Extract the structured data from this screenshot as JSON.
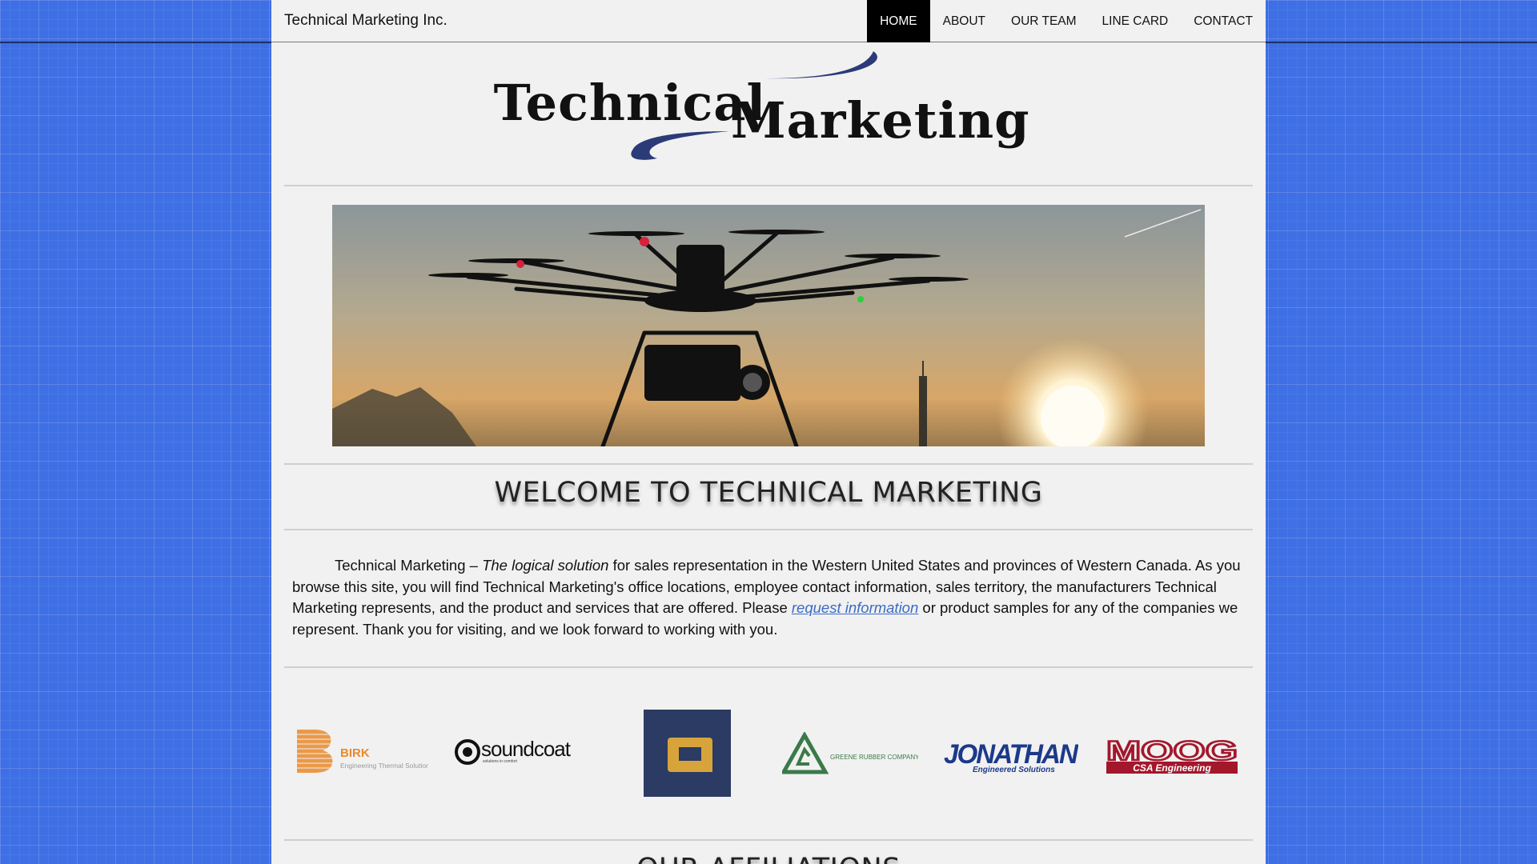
{
  "header": {
    "brand": "Technical Marketing Inc.",
    "nav": [
      {
        "label": "HOME",
        "active": true
      },
      {
        "label": "ABOUT",
        "active": false
      },
      {
        "label": "OUR TEAM",
        "active": false
      },
      {
        "label": "LINE CARD",
        "active": false
      },
      {
        "label": "CONTACT",
        "active": false
      }
    ]
  },
  "logo": {
    "word1": "Technical",
    "word2": "Marketing",
    "swoosh_color": "#2b3b78"
  },
  "main": {
    "welcome_title": "WELCOME TO TECHNICAL MARKETING",
    "intro": {
      "part1": "Technical Marketing – ",
      "emphasis": "The logical solution",
      "part2": " for sales representation in the Western United States and provinces of Western Canada. As you browse this site, you will find Technical Marketing's office locations, employee contact information, sales territory, the manufacturers Technical Marketing represents, and the product and services that are offered. Please ",
      "link": "request information",
      "part3": " or product samples for any of the companies we represent. Thank you for visiting, and we look forward to working with you."
    },
    "partners": {
      "birk": {
        "name": "BIRK",
        "tagline": "Engineering Thermal Solutions",
        "color": "#e98a2b"
      },
      "soundcoat": {
        "name": "soundcoat",
        "tagline": "solutions in comfort"
      },
      "q_logo": {
        "bg": "#2b3b63",
        "fg": "#d6a43a"
      },
      "greene": {
        "name": "GREENE RUBBER COMPANY",
        "color": "#3a7a4a"
      },
      "jonathan": {
        "name": "JONATHAN",
        "tagline": "Engineered Solutions",
        "color": "#1c3a8a"
      },
      "moog": {
        "name": "MOOG",
        "tagline": "CSA Engineering",
        "color": "#a3172c"
      }
    },
    "affiliations_title": "OUR AFFILIATIONS"
  }
}
